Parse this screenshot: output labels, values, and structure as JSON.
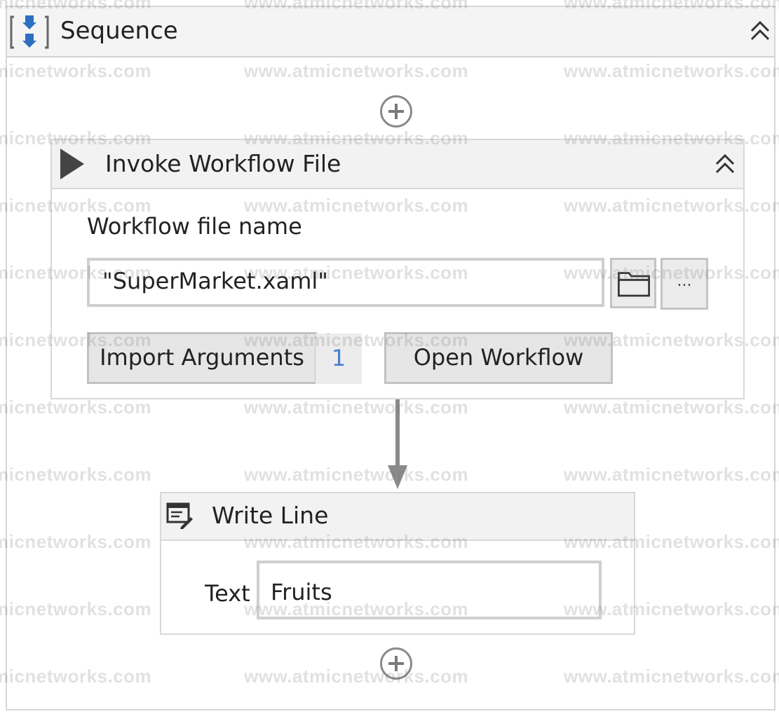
{
  "sequence": {
    "title": "Sequence"
  },
  "invoke_workflow": {
    "title": "Invoke Workflow File",
    "file_label": "Workflow file name",
    "file_value": "\"SuperMarket.xaml\"",
    "browse_label": "...",
    "import_arguments_label": "Import Arguments",
    "argument_count": "1",
    "open_workflow_label": "Open Workflow"
  },
  "write_line": {
    "title": "Write Line",
    "text_label": "Text",
    "text_value": "Fruits"
  },
  "watermark": {
    "text": "www.atmicnetworks.com"
  },
  "icons": {
    "sequence": "sequence-icon",
    "collapse": "double-chevron-up-icon",
    "add": "plus-circle-icon",
    "play": "play-icon",
    "folder": "folder-icon",
    "write_line": "write-line-icon"
  },
  "colors": {
    "header_bg": "#f2f2f2",
    "border": "#d6d6d6",
    "sequence_icon_blue": "#2e6fc4",
    "argument_count": "#4a7fd0",
    "connector": "#8a8a8a"
  }
}
